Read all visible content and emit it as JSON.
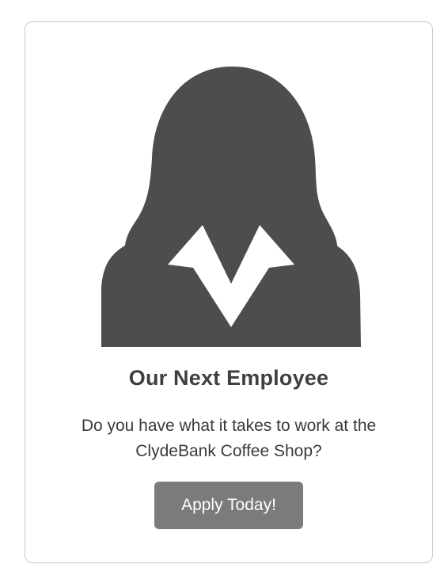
{
  "card": {
    "avatar_icon": "female-user-silhouette-icon",
    "title": "Our Next Employee",
    "subtitle_line1": "Do you have what it takes to work at the",
    "subtitle_line2": "ClydeBank Coffee Shop?",
    "button_label": "Apply Today!"
  },
  "colors": {
    "silhouette": "#4d4d4f",
    "collar": "#ffffff",
    "title_text": "#3f3f41",
    "button_bg": "#7b7b7d",
    "button_text": "#ffffff",
    "card_border": "#c9c9c9"
  }
}
